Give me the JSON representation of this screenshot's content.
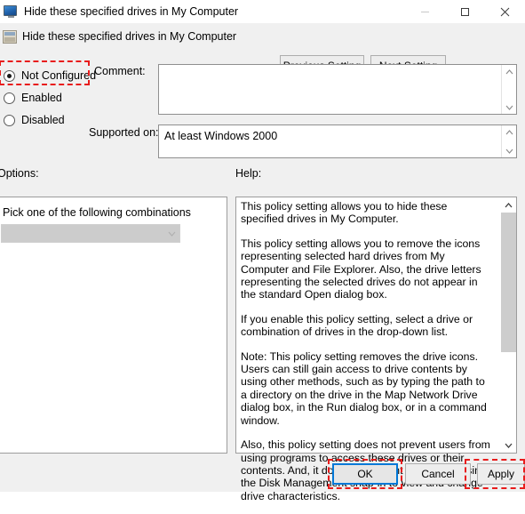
{
  "window": {
    "title": "Hide these specified drives in My Computer",
    "icon": "monitor-icon",
    "controls": {
      "minimize": "–",
      "maximize": "□",
      "close": "✕"
    }
  },
  "header": {
    "icon": "policy-setting-icon",
    "title": "Hide these specified drives in My Computer",
    "previous_setting_label": "Previous Setting",
    "next_setting_label": "Next Setting"
  },
  "state": {
    "radios": [
      {
        "label": "Not Configured",
        "selected": true
      },
      {
        "label": "Enabled",
        "selected": false
      },
      {
        "label": "Disabled",
        "selected": false
      }
    ],
    "comment_label": "Comment:",
    "comment_value": "",
    "supported_label": "Supported on:",
    "supported_value": "At least Windows 2000"
  },
  "options": {
    "section_label": "Options:",
    "instruction": "Pick one of the following combinations",
    "combo_value": "",
    "combo_enabled": false,
    "combo_arrow": "chevron-down-icon"
  },
  "help": {
    "section_label": "Help:",
    "paragraphs": [
      "This policy setting allows you to hide these specified drives in My Computer.",
      "This policy setting allows you to remove the icons representing selected hard drives from My Computer and File Explorer. Also, the drive letters representing the selected drives do not appear in the standard Open dialog box.",
      "If you enable this policy setting, select a drive or combination of drives in the drop-down list.",
      "Note: This policy setting removes the drive icons. Users can still gain access to drive contents by using other methods, such as by typing the path to a directory on the drive in the Map Network Drive dialog box, in the Run dialog box, or in a command window.",
      "Also, this policy setting does not prevent users from using programs to access these drives or their contents. And, it does not prevent users from using the Disk Management snap-in to view and change drive characteristics."
    ],
    "scroll_up": "scroll-up-arrow",
    "scroll_down": "scroll-down-arrow",
    "scroll_thumb_percent": 62
  },
  "footer": {
    "ok_label": "OK",
    "cancel_label": "Cancel",
    "apply_label": "Apply"
  },
  "highlights": {
    "color": "#e81c1c",
    "targets": [
      "not-configured-radio",
      "ok-button",
      "apply-button"
    ]
  }
}
